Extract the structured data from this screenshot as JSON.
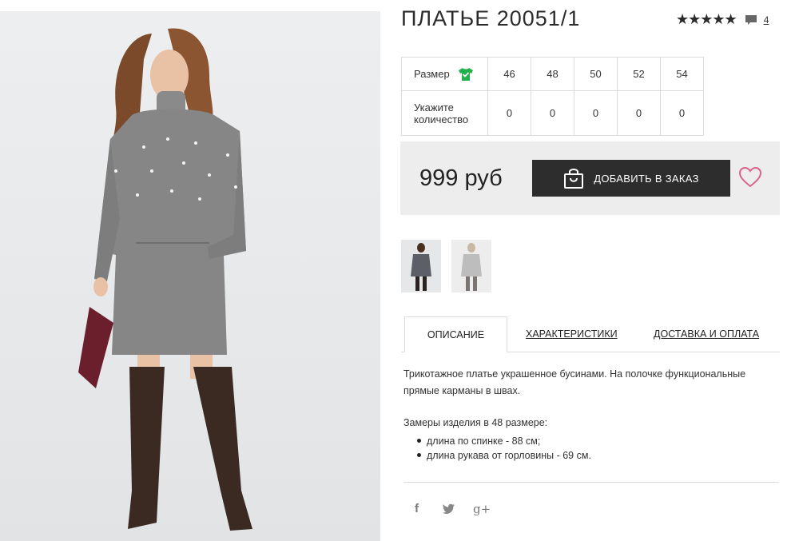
{
  "product": {
    "title": "ПЛАТЬЕ 20051/1",
    "rating_stars": "★★★★★",
    "comments_count": "4"
  },
  "sizes": {
    "size_label": "Размер",
    "qty_label": "Укажите количество",
    "values": [
      "46",
      "48",
      "50",
      "52",
      "54"
    ],
    "quantities": [
      "0",
      "0",
      "0",
      "0",
      "0"
    ]
  },
  "order": {
    "price": "999 руб",
    "add_button": "ДОБАВИТЬ В ЗАКАЗ"
  },
  "tabs": [
    {
      "label": "ОПИСАНИЕ",
      "active": true
    },
    {
      "label": "ХАРАКТЕРИСТИКИ",
      "active": false
    },
    {
      "label": "ДОСТАВКА И ОПЛАТА",
      "active": false
    }
  ],
  "description": {
    "text": "Трикотажное платье украшенное бусинами. На полочке функциональные прямые карманы в швах.",
    "measurements_title": "Замеры изделия в 48 размере:",
    "measurements": [
      "длина по спинке - 88 см;",
      "длина рукава от горловины - 69 см."
    ]
  },
  "social": {
    "facebook": "f",
    "twitter": "🐦",
    "google_plus": "g+"
  },
  "colors": {
    "accent_green": "#22b14c",
    "button_dark": "#2d2d2d",
    "heart_pink": "#d9628a",
    "order_box_bg": "#ededed"
  }
}
